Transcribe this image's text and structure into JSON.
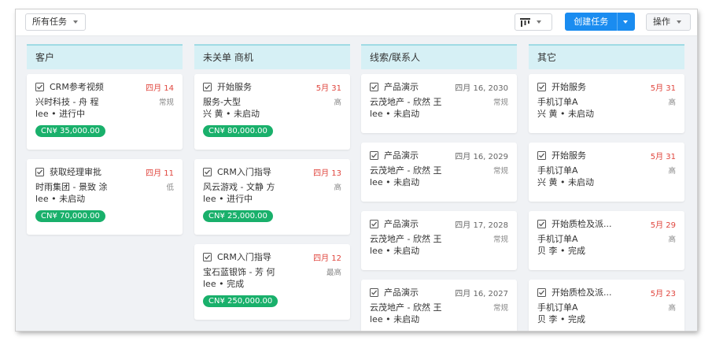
{
  "toolbar": {
    "filter_label": "所有任务",
    "view_icon": "column-view-icon",
    "create_label": "创建任务",
    "ops_label": "操作"
  },
  "columns": [
    {
      "title": "客户",
      "cards": [
        {
          "title": "CRM参考视频",
          "date": "四月 14",
          "overdue": true,
          "line2": "兴时科技 - 舟 程",
          "priority": "常规",
          "line3": "lee • 进行中",
          "amount": "CN¥ 35,000.00"
        },
        {
          "title": "获取经理审批",
          "date": "四月 11",
          "overdue": true,
          "line2": "时雨集团 - 景致 涂",
          "priority": "低",
          "line3": "lee • 未启动",
          "amount": "CN¥ 70,000.00"
        }
      ]
    },
    {
      "title": "未关单 商机",
      "cards": [
        {
          "title": "开始服务",
          "date": "5月 31",
          "overdue": true,
          "line2": "服务-大型",
          "priority": "高",
          "line3": "兴 黄 • 未启动",
          "amount": "CN¥ 80,000.00"
        },
        {
          "title": "CRM入门指导",
          "date": "四月 13",
          "overdue": true,
          "line2": "风云游戏 - 文静 方",
          "priority": "高",
          "line3": "lee • 进行中",
          "amount": "CN¥ 25,000.00"
        },
        {
          "title": "CRM入门指导",
          "date": "四月 12",
          "overdue": true,
          "line2": "宝石蓝银饰 - 芳 何",
          "priority": "最高",
          "line3": "lee • 完成",
          "amount": "CN¥ 250,000.00"
        }
      ]
    },
    {
      "title": "线索/联系人",
      "cards": [
        {
          "title": "产品演示",
          "date": "四月 16, 2030",
          "overdue": false,
          "line2": "云茂地产 - 欣然 王",
          "priority": "常规",
          "line3": "lee • 未启动"
        },
        {
          "title": "产品演示",
          "date": "四月 16, 2029",
          "overdue": false,
          "line2": "云茂地产 - 欣然 王",
          "priority": "常规",
          "line3": "lee • 未启动"
        },
        {
          "title": "产品演示",
          "date": "四月 17, 2028",
          "overdue": false,
          "line2": "云茂地产 - 欣然 王",
          "priority": "常规",
          "line3": "lee • 未启动"
        },
        {
          "title": "产品演示",
          "date": "四月 16, 2027",
          "overdue": false,
          "line2": "云茂地产 - 欣然 王",
          "priority": "常规",
          "line3": "lee • 未启动"
        }
      ]
    },
    {
      "title": "其它",
      "cards": [
        {
          "title": "开始服务",
          "date": "5月 31",
          "overdue": true,
          "line2": "手机订单A",
          "priority": "高",
          "line3": "兴 黄 • 未启动"
        },
        {
          "title": "开始服务",
          "date": "5月 31",
          "overdue": true,
          "line2": "手机订单A",
          "priority": "高",
          "line3": "兴 黄 • 未启动"
        },
        {
          "title": "开始质检及派...",
          "date": "5月 29",
          "overdue": true,
          "line2": "手机订单A",
          "priority": "高",
          "line3": "贝 李 • 完成"
        },
        {
          "title": "开始质检及派...",
          "date": "5月 23",
          "overdue": true,
          "line2": "手机订单A",
          "priority": "高",
          "line3": "贝 李 • 完成"
        }
      ]
    }
  ],
  "colors": {
    "accent": "#1a8cf0",
    "overdue": "#e0463e",
    "amount_badge": "#19b06b",
    "column_header": "#d6f0f5"
  }
}
